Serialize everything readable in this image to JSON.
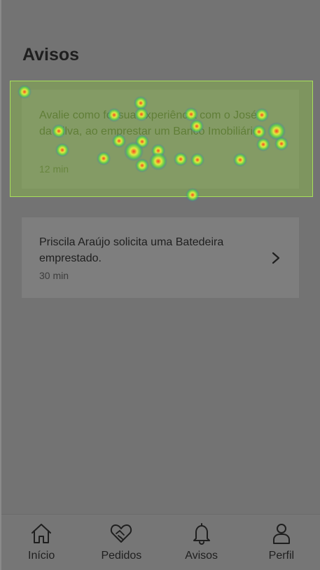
{
  "page": {
    "title": "Avisos"
  },
  "notifications": [
    {
      "text": "Avalie como foi sua experiência com o José da Silva, ao emprestar um Banco Imobiliário",
      "time": "12 min",
      "highlighted": true
    },
    {
      "text": "Priscila Araújo solicita uma Batedeira emprestado.",
      "time": "30 min",
      "has_chevron": true
    }
  ],
  "tabbar": {
    "items": [
      {
        "label": "Início",
        "icon": "home-icon"
      },
      {
        "label": "Pedidos",
        "icon": "handshake-heart-icon"
      },
      {
        "label": "Avisos",
        "icon": "bell-icon"
      },
      {
        "label": "Perfil",
        "icon": "user-icon"
      }
    ]
  },
  "colors": {
    "background": "#737373",
    "card": "#7e7e7e",
    "highlight": "#a8e05a"
  }
}
